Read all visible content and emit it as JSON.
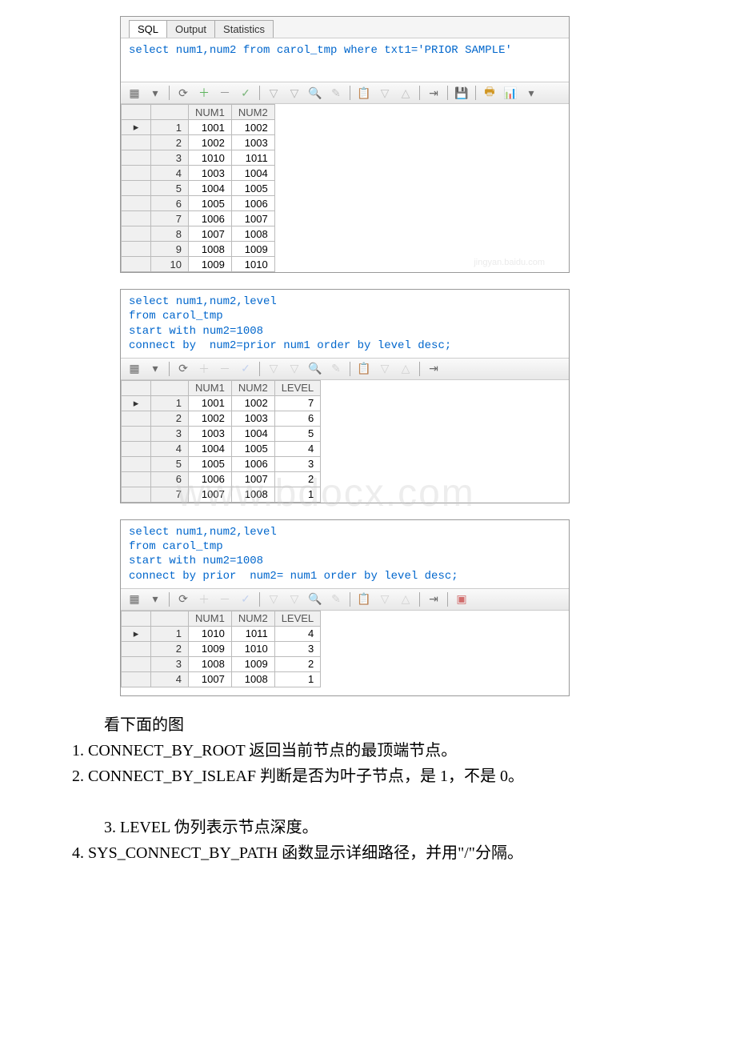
{
  "block1": {
    "tabs": [
      "SQL",
      "Output",
      "Statistics"
    ],
    "sql": "select num1,num2 from carol_tmp where txt1='PRIOR SAMPLE'",
    "columns": [
      "NUM1",
      "NUM2"
    ],
    "rows": [
      {
        "n": 1,
        "num1": 1001,
        "num2": 1002
      },
      {
        "n": 2,
        "num1": 1002,
        "num2": 1003
      },
      {
        "n": 3,
        "num1": 1010,
        "num2": 1011
      },
      {
        "n": 4,
        "num1": 1003,
        "num2": 1004
      },
      {
        "n": 5,
        "num1": 1004,
        "num2": 1005
      },
      {
        "n": 6,
        "num1": 1005,
        "num2": 1006
      },
      {
        "n": 7,
        "num1": 1006,
        "num2": 1007
      },
      {
        "n": 8,
        "num1": 1007,
        "num2": 1008
      },
      {
        "n": 9,
        "num1": 1008,
        "num2": 1009
      },
      {
        "n": 10,
        "num1": 1009,
        "num2": 1010
      }
    ]
  },
  "block2": {
    "sql_lines": [
      "select num1,num2,level",
      "from carol_tmp",
      "start with num2=1008",
      "connect by  num2=prior num1 order by level desc;"
    ],
    "columns": [
      "NUM1",
      "NUM2",
      "LEVEL"
    ],
    "rows": [
      {
        "n": 1,
        "num1": 1001,
        "num2": 1002,
        "level": 7
      },
      {
        "n": 2,
        "num1": 1002,
        "num2": 1003,
        "level": 6
      },
      {
        "n": 3,
        "num1": 1003,
        "num2": 1004,
        "level": 5
      },
      {
        "n": 4,
        "num1": 1004,
        "num2": 1005,
        "level": 4
      },
      {
        "n": 5,
        "num1": 1005,
        "num2": 1006,
        "level": 3
      },
      {
        "n": 6,
        "num1": 1006,
        "num2": 1007,
        "level": 2
      },
      {
        "n": 7,
        "num1": 1007,
        "num2": 1008,
        "level": 1
      }
    ],
    "watermark": "www.bdocx.com"
  },
  "block3": {
    "sql_lines": [
      "select num1,num2,level",
      "from carol_tmp",
      "start with num2=1008",
      "connect by prior  num2= num1 order by level desc;"
    ],
    "columns": [
      "NUM1",
      "NUM2",
      "LEVEL"
    ],
    "rows": [
      {
        "n": 1,
        "num1": 1010,
        "num2": 1011,
        "level": 4
      },
      {
        "n": 2,
        "num1": 1009,
        "num2": 1010,
        "level": 3
      },
      {
        "n": 3,
        "num1": 1008,
        "num2": 1009,
        "level": 2
      },
      {
        "n": 4,
        "num1": 1007,
        "num2": 1008,
        "level": 1
      }
    ]
  },
  "notes": {
    "l0": "看下面的图",
    "l1": "1. CONNECT_BY_ROOT 返回当前节点的最顶端节点。",
    "l2": "2. CONNECT_BY_ISLEAF 判断是否为叶子节点，是 1，不是 0。",
    "l3": "3. LEVEL 伪列表示节点深度。",
    "l4": "4. SYS_CONNECT_BY_PATH 函数显示详细路径，并用\"/\"分隔。"
  }
}
